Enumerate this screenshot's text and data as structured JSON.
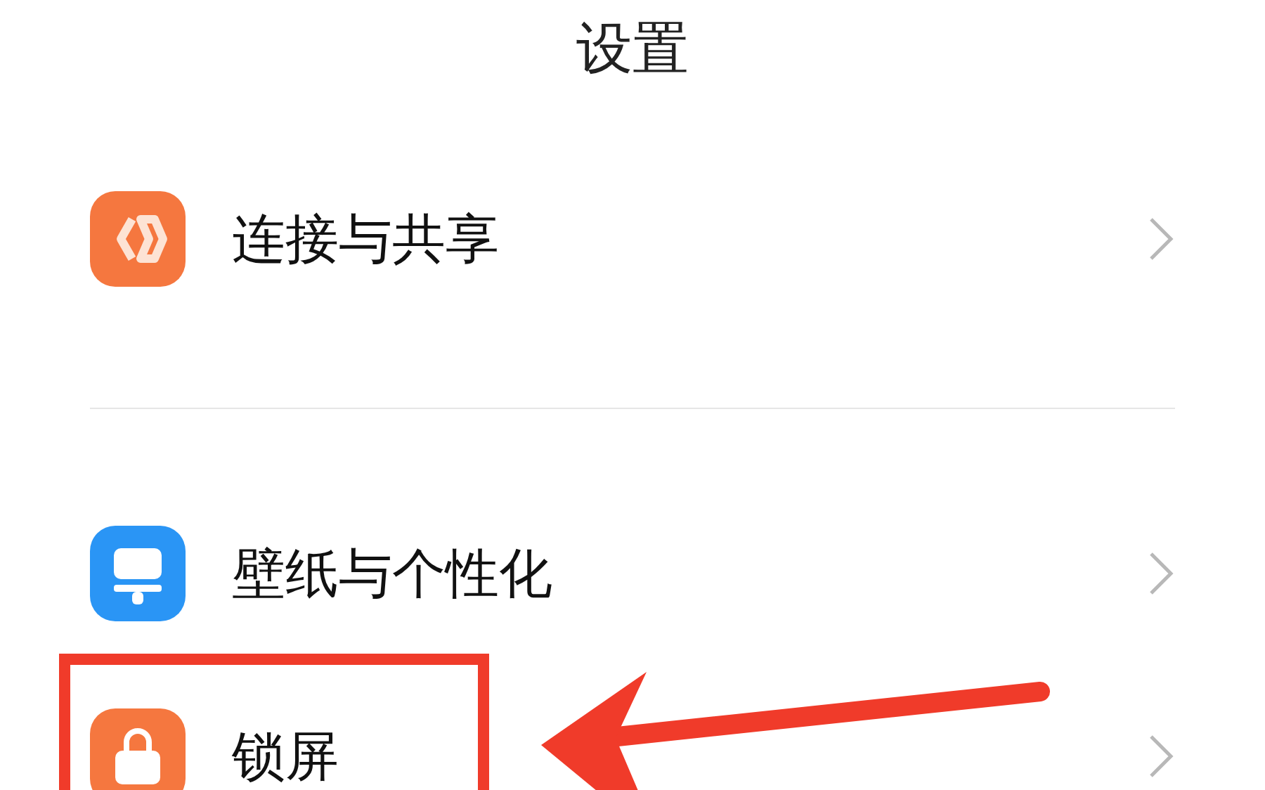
{
  "title": "设置",
  "sections": [
    {
      "items": [
        {
          "label": "连接与共享",
          "kind": "link",
          "color": "#f5773f",
          "highlighted": false
        }
      ]
    },
    {
      "items": [
        {
          "label": "壁纸与个性化",
          "kind": "brush",
          "color": "#2a95f5",
          "highlighted": false
        },
        {
          "label": "锁屏",
          "kind": "lock",
          "color": "#f5773f",
          "highlighted": true
        }
      ]
    }
  ]
}
